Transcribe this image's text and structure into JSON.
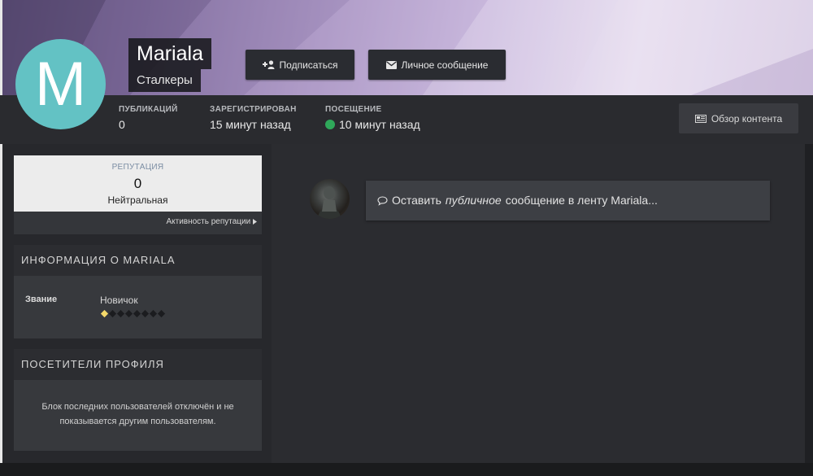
{
  "profile": {
    "avatar_letter": "M",
    "avatar_color": "#63c2c4",
    "name": "Mariala",
    "group": "Сталкеры"
  },
  "buttons": {
    "follow": "Подписаться",
    "follow_icon": "user-plus-icon",
    "message": "Личное сообщение",
    "message_icon": "envelope-icon",
    "browse_content": "Обзор контента",
    "browse_icon": "newspaper-icon"
  },
  "stats": {
    "posts_label": "ПУБЛИКАЦИЙ",
    "posts_value": "0",
    "joined_label": "ЗАРЕГИСТРИРОВАН",
    "joined_value": "15 минут назад",
    "visited_label": "ПОСЕЩЕНИЕ",
    "visited_value": "10 минут назад",
    "online_color": "#2fa85a"
  },
  "reputation": {
    "label": "РЕПУТАЦИЯ",
    "value": "0",
    "text": "Нейтральная",
    "activity_link": "Активность репутации"
  },
  "about": {
    "title": "ИНФОРМАЦИЯ О MARIALA",
    "rank_label": "Звание",
    "rank_value": "Новичок",
    "rank_pips_filled": 1,
    "rank_pips_total": 8,
    "pip_active_color": "#f5d96a"
  },
  "visitors": {
    "title": "ПОСЕТИТЕЛИ ПРОФИЛЯ",
    "message": "Блок последних пользователей отключён и не показывается другим пользователям."
  },
  "feed": {
    "prefix": "Оставить",
    "emphasis": "публичное",
    "suffix": "сообщение в ленту Mariala...",
    "icon": "comment-icon"
  }
}
